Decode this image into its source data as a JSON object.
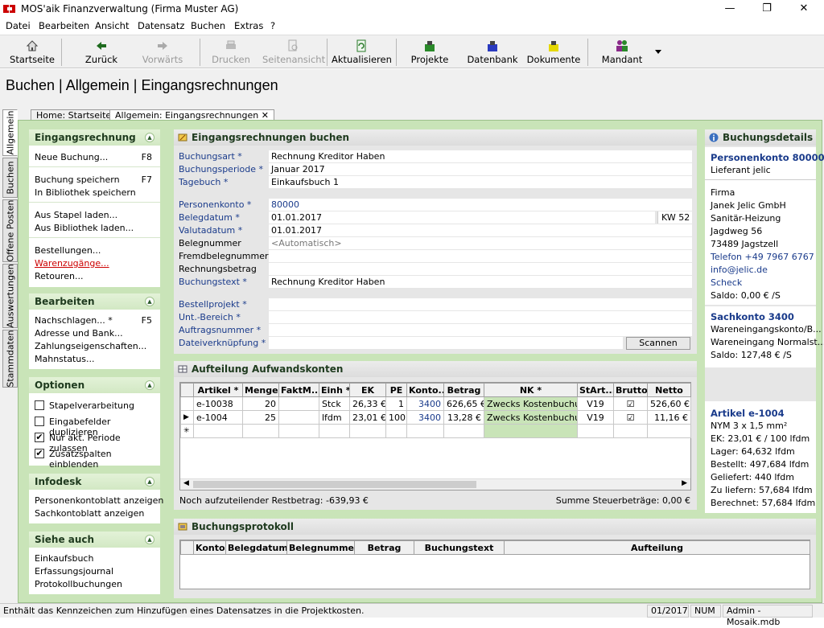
{
  "window": {
    "title": "MOS'aik Finanzverwaltung (Firma Muster AG)",
    "minimize": "—",
    "maximize": "❐",
    "close": "✕"
  },
  "menu": [
    "Datei",
    "Bearbeiten",
    "Ansicht",
    "Datensatz",
    "Buchen",
    "Extras",
    "?"
  ],
  "toolbar": {
    "start": "Startseite",
    "back": "Zurück",
    "forward": "Vorwärts",
    "print": "Drucken",
    "preview": "Seitenansicht",
    "refresh": "Aktualisieren",
    "projects": "Projekte",
    "database": "Datenbank",
    "documents": "Dokumente",
    "client": "Mandant"
  },
  "page_title": "Buchen | Allgemein | Eingangsrechnungen",
  "vtabs": [
    "Allgemein",
    "Buchen",
    "Offene Posten",
    "Auswertungen",
    "Stammdaten"
  ],
  "doctabs": {
    "home": "Home: Startseite",
    "current": "Allgemein: Eingangsrechnungen",
    "close": "✕"
  },
  "sidebar": {
    "eingangsrechnung": {
      "title": "Eingangsrechnung",
      "new": "Neue Buchung...",
      "new_key": "F8",
      "save": "Buchung speichern",
      "save_key": "F7",
      "save_lib": "In Bibliothek speichern",
      "from_stack": "Aus Stapel laden...",
      "from_lib": "Aus Bibliothek laden...",
      "orders": "Bestellungen...",
      "receipts": "Warenzugänge...",
      "returns": "Retouren..."
    },
    "bearbeiten": {
      "title": "Bearbeiten",
      "lookup": "Nachschlagen... *",
      "lookup_key": "F5",
      "address": "Adresse und Bank...",
      "payment": "Zahlungseigenschaften...",
      "dunning": "Mahnstatus..."
    },
    "optionen": {
      "title": "Optionen",
      "items": [
        {
          "label": "Stapelverarbeitung",
          "checked": false
        },
        {
          "label": "Eingabefelder duplizieren",
          "checked": false
        },
        {
          "label": "Nur akt. Periode zulassen",
          "checked": true
        },
        {
          "label": "Zusatzspalten einblenden",
          "checked": true
        }
      ]
    },
    "infodesk": {
      "title": "Infodesk",
      "personal": "Personenkontoblatt anzeigen",
      "ledger": "Sachkontoblatt anzeigen"
    },
    "siehe": {
      "title": "Siehe auch",
      "book": "Einkaufsbuch",
      "journal": "Erfassungsjournal",
      "protocol": "Protokollbuchungen"
    }
  },
  "form": {
    "title": "Eingangsrechnungen buchen",
    "buchungsart": {
      "label": "Buchungsart *",
      "value": "Rechnung Kreditor Haben"
    },
    "periode": {
      "label": "Buchungsperiode *",
      "value": "Januar 2017"
    },
    "tagebuch": {
      "label": "Tagebuch *",
      "value": "Einkaufsbuch 1"
    },
    "personenkonto": {
      "label": "Personenkonto *",
      "value": "80000"
    },
    "belegdatum": {
      "label": "Belegdatum *",
      "value": "01.01.2017",
      "week": "KW 52"
    },
    "valutadatum": {
      "label": "Valutadatum *",
      "value": "01.01.2017"
    },
    "belegnummer": {
      "label": "Belegnummer",
      "value": "<Automatisch>"
    },
    "fremdbeleg": {
      "label": "Fremdbelegnummer",
      "value": ""
    },
    "betrag": {
      "label": "Rechnungsbetrag",
      "value": ""
    },
    "buchungstext": {
      "label": "Buchungstext *",
      "value": "Rechnung Kreditor Haben"
    },
    "bestellprojekt": {
      "label": "Bestellprojekt *",
      "value": ""
    },
    "untbereich": {
      "label": "Unt.-Bereich *",
      "value": ""
    },
    "auftragsnummer": {
      "label": "Auftragsnummer *",
      "value": ""
    },
    "datei": {
      "label": "Dateiverknüpfung *",
      "value": ""
    },
    "scan": "Scannen"
  },
  "aufteilung": {
    "title": "Aufteilung Aufwandskonten",
    "columns": [
      "Artikel *",
      "Menge",
      "FaktM...",
      "Einh *",
      "EK",
      "PE",
      "Konto...",
      "Betrag",
      "NK *",
      "StArt...",
      "Brutto",
      "Netto"
    ],
    "rows": [
      {
        "artikel": "e-10038",
        "menge": "20",
        "faktm": "",
        "einh": "Stck",
        "ek": "26,33 €",
        "pe": "1",
        "konto": "3400",
        "betrag": "626,65 €",
        "nk": "Zwecks Kostenbuchung",
        "start": "V19",
        "brutto": "☑",
        "netto": "526,60 €"
      },
      {
        "artikel": "e-1004",
        "menge": "25",
        "faktm": "",
        "einh": "lfdm",
        "ek": "23,01 €",
        "pe": "100",
        "konto": "3400",
        "betrag": "13,28 €",
        "nk": "Zwecks Kostenbuchung",
        "start": "V19",
        "brutto": "☑",
        "netto": "11,16 €"
      }
    ],
    "current_marker": "▶",
    "new_marker": "✳",
    "rest": "Noch aufzuteilender Restbetrag: -639,93 €",
    "tax": "Summe Steuerbeträge: 0,00 €"
  },
  "protokoll": {
    "title": "Buchungsprotokoll",
    "columns": [
      "Konto",
      "Belegdatum",
      "Belegnummer",
      "Betrag",
      "Buchungstext",
      "Aufteilung"
    ]
  },
  "details": {
    "title": "Buchungsdetails",
    "personenkonto": "Personenkonto 80000",
    "lieferant": "Lieferant jelic",
    "firma": "Firma",
    "name": "Janek Jelic GmbH",
    "branche": "Sanitär-Heizung",
    "strasse": "Jagdweg 56",
    "ort": "73489 Jagstzell",
    "telefon": "Telefon +49 7967 6767",
    "email": "info@jelic.de",
    "scheck": "Scheck",
    "saldo1": "Saldo: 0,00 € /S",
    "sachkonto": "Sachkonto 3400",
    "wk1": "Wareneingangskonto/B...",
    "wk2": "Wareneingang Normalst...",
    "saldo2": "Saldo: 127,48 € /S",
    "artikel": "Artikel e-1004",
    "art1": "NYM 3 x 1,5 mm²",
    "art2": "EK: 23,01 € / 100 lfdm",
    "art3": "Lager: 64,632 lfdm",
    "art4": "Bestellt: 497,684 lfdm",
    "art5": "Geliefert: 440 lfdm",
    "art6": "Zu liefern: 57,684 lfdm",
    "art7": "Berechnet: 57,684 lfdm"
  },
  "status": {
    "text": "Enthält das Kennzeichen zum Hinzufügen eines Datensatzes in die Projektkosten.",
    "period": "01/2017",
    "num": "NUM",
    "db": "Admin - Mosaik.mdb"
  }
}
